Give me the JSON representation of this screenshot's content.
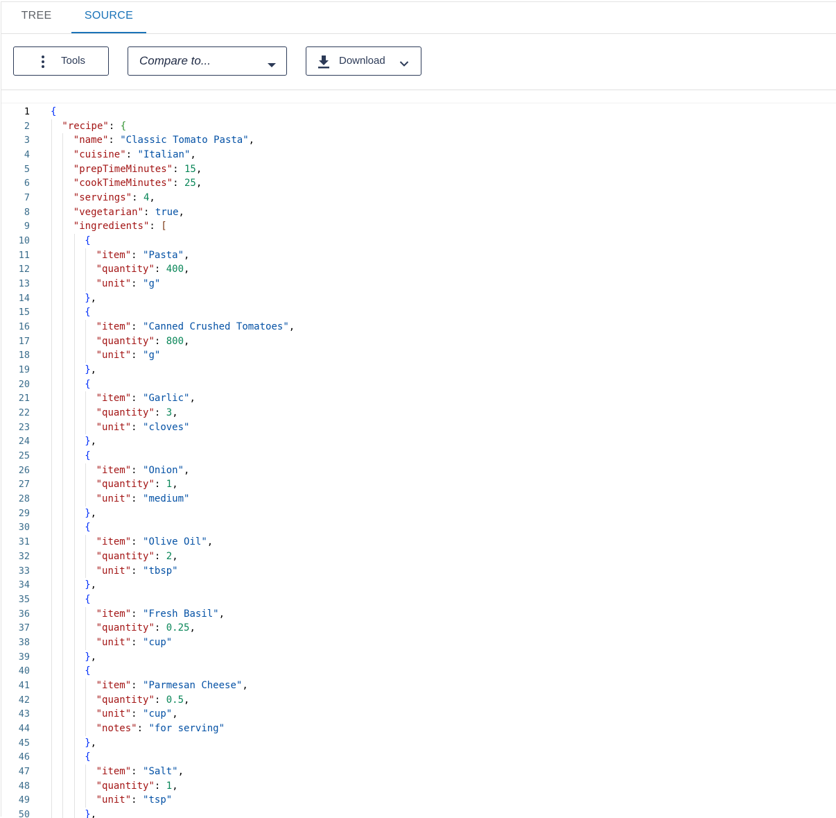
{
  "tabs": [
    {
      "label": "TREE",
      "active": false
    },
    {
      "label": "SOURCE",
      "active": true
    }
  ],
  "toolbar": {
    "tools_label": "Tools",
    "compare_placeholder": "Compare to...",
    "download_label": "Download"
  },
  "colors": {
    "accent": "#1a73b8",
    "key": "#a31515",
    "string": "#0451a5",
    "number": "#098658",
    "bracket_level1": "#0431fa",
    "bracket_level2": "#319331",
    "bracket_level3": "#7b3814"
  },
  "editor": {
    "current_line": 1,
    "lines": [
      [
        [
          "br1",
          "{"
        ]
      ],
      [
        [
          "key",
          "\"recipe\""
        ],
        [
          "p",
          ": "
        ],
        [
          "br2",
          "{"
        ]
      ],
      [
        [
          "key",
          "\"name\""
        ],
        [
          "p",
          ": "
        ],
        [
          "str",
          "\"Classic Tomato Pasta\""
        ],
        [
          "p",
          ","
        ]
      ],
      [
        [
          "key",
          "\"cuisine\""
        ],
        [
          "p",
          ": "
        ],
        [
          "str",
          "\"Italian\""
        ],
        [
          "p",
          ","
        ]
      ],
      [
        [
          "key",
          "\"prepTimeMinutes\""
        ],
        [
          "p",
          ": "
        ],
        [
          "num",
          "15"
        ],
        [
          "p",
          ","
        ]
      ],
      [
        [
          "key",
          "\"cookTimeMinutes\""
        ],
        [
          "p",
          ": "
        ],
        [
          "num",
          "25"
        ],
        [
          "p",
          ","
        ]
      ],
      [
        [
          "key",
          "\"servings\""
        ],
        [
          "p",
          ": "
        ],
        [
          "num",
          "4"
        ],
        [
          "p",
          ","
        ]
      ],
      [
        [
          "key",
          "\"vegetarian\""
        ],
        [
          "p",
          ": "
        ],
        [
          "bool",
          "true"
        ],
        [
          "p",
          ","
        ]
      ],
      [
        [
          "key",
          "\"ingredients\""
        ],
        [
          "p",
          ": "
        ],
        [
          "br3",
          "["
        ]
      ],
      [
        [
          "br1",
          "{"
        ]
      ],
      [
        [
          "key",
          "\"item\""
        ],
        [
          "p",
          ": "
        ],
        [
          "str",
          "\"Pasta\""
        ],
        [
          "p",
          ","
        ]
      ],
      [
        [
          "key",
          "\"quantity\""
        ],
        [
          "p",
          ": "
        ],
        [
          "num",
          "400"
        ],
        [
          "p",
          ","
        ]
      ],
      [
        [
          "key",
          "\"unit\""
        ],
        [
          "p",
          ": "
        ],
        [
          "str",
          "\"g\""
        ]
      ],
      [
        [
          "br1",
          "}"
        ],
        [
          "p",
          ","
        ]
      ],
      [
        [
          "br1",
          "{"
        ]
      ],
      [
        [
          "key",
          "\"item\""
        ],
        [
          "p",
          ": "
        ],
        [
          "str",
          "\"Canned Crushed Tomatoes\""
        ],
        [
          "p",
          ","
        ]
      ],
      [
        [
          "key",
          "\"quantity\""
        ],
        [
          "p",
          ": "
        ],
        [
          "num",
          "800"
        ],
        [
          "p",
          ","
        ]
      ],
      [
        [
          "key",
          "\"unit\""
        ],
        [
          "p",
          ": "
        ],
        [
          "str",
          "\"g\""
        ]
      ],
      [
        [
          "br1",
          "}"
        ],
        [
          "p",
          ","
        ]
      ],
      [
        [
          "br1",
          "{"
        ]
      ],
      [
        [
          "key",
          "\"item\""
        ],
        [
          "p",
          ": "
        ],
        [
          "str",
          "\"Garlic\""
        ],
        [
          "p",
          ","
        ]
      ],
      [
        [
          "key",
          "\"quantity\""
        ],
        [
          "p",
          ": "
        ],
        [
          "num",
          "3"
        ],
        [
          "p",
          ","
        ]
      ],
      [
        [
          "key",
          "\"unit\""
        ],
        [
          "p",
          ": "
        ],
        [
          "str",
          "\"cloves\""
        ]
      ],
      [
        [
          "br1",
          "}"
        ],
        [
          "p",
          ","
        ]
      ],
      [
        [
          "br1",
          "{"
        ]
      ],
      [
        [
          "key",
          "\"item\""
        ],
        [
          "p",
          ": "
        ],
        [
          "str",
          "\"Onion\""
        ],
        [
          "p",
          ","
        ]
      ],
      [
        [
          "key",
          "\"quantity\""
        ],
        [
          "p",
          ": "
        ],
        [
          "num",
          "1"
        ],
        [
          "p",
          ","
        ]
      ],
      [
        [
          "key",
          "\"unit\""
        ],
        [
          "p",
          ": "
        ],
        [
          "str",
          "\"medium\""
        ]
      ],
      [
        [
          "br1",
          "}"
        ],
        [
          "p",
          ","
        ]
      ],
      [
        [
          "br1",
          "{"
        ]
      ],
      [
        [
          "key",
          "\"item\""
        ],
        [
          "p",
          ": "
        ],
        [
          "str",
          "\"Olive Oil\""
        ],
        [
          "p",
          ","
        ]
      ],
      [
        [
          "key",
          "\"quantity\""
        ],
        [
          "p",
          ": "
        ],
        [
          "num",
          "2"
        ],
        [
          "p",
          ","
        ]
      ],
      [
        [
          "key",
          "\"unit\""
        ],
        [
          "p",
          ": "
        ],
        [
          "str",
          "\"tbsp\""
        ]
      ],
      [
        [
          "br1",
          "}"
        ],
        [
          "p",
          ","
        ]
      ],
      [
        [
          "br1",
          "{"
        ]
      ],
      [
        [
          "key",
          "\"item\""
        ],
        [
          "p",
          ": "
        ],
        [
          "str",
          "\"Fresh Basil\""
        ],
        [
          "p",
          ","
        ]
      ],
      [
        [
          "key",
          "\"quantity\""
        ],
        [
          "p",
          ": "
        ],
        [
          "num",
          "0.25"
        ],
        [
          "p",
          ","
        ]
      ],
      [
        [
          "key",
          "\"unit\""
        ],
        [
          "p",
          ": "
        ],
        [
          "str",
          "\"cup\""
        ]
      ],
      [
        [
          "br1",
          "}"
        ],
        [
          "p",
          ","
        ]
      ],
      [
        [
          "br1",
          "{"
        ]
      ],
      [
        [
          "key",
          "\"item\""
        ],
        [
          "p",
          ": "
        ],
        [
          "str",
          "\"Parmesan Cheese\""
        ],
        [
          "p",
          ","
        ]
      ],
      [
        [
          "key",
          "\"quantity\""
        ],
        [
          "p",
          ": "
        ],
        [
          "num",
          "0.5"
        ],
        [
          "p",
          ","
        ]
      ],
      [
        [
          "key",
          "\"unit\""
        ],
        [
          "p",
          ": "
        ],
        [
          "str",
          "\"cup\""
        ],
        [
          "p",
          ","
        ]
      ],
      [
        [
          "key",
          "\"notes\""
        ],
        [
          "p",
          ": "
        ],
        [
          "str",
          "\"for serving\""
        ]
      ],
      [
        [
          "br1",
          "}"
        ],
        [
          "p",
          ","
        ]
      ],
      [
        [
          "br1",
          "{"
        ]
      ],
      [
        [
          "key",
          "\"item\""
        ],
        [
          "p",
          ": "
        ],
        [
          "str",
          "\"Salt\""
        ],
        [
          "p",
          ","
        ]
      ],
      [
        [
          "key",
          "\"quantity\""
        ],
        [
          "p",
          ": "
        ],
        [
          "num",
          "1"
        ],
        [
          "p",
          ","
        ]
      ],
      [
        [
          "key",
          "\"unit\""
        ],
        [
          "p",
          ": "
        ],
        [
          "str",
          "\"tsp\""
        ]
      ],
      [
        [
          "br1",
          "}"
        ],
        [
          "p",
          ","
        ]
      ]
    ]
  }
}
